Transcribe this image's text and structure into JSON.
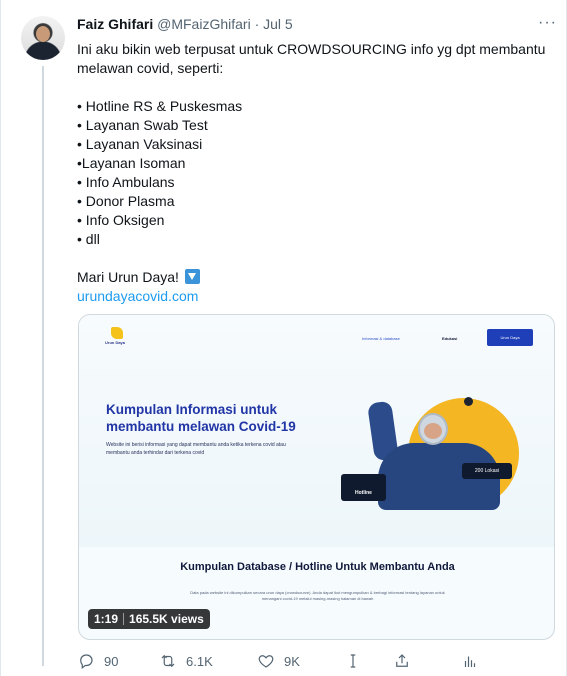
{
  "author": {
    "name": "Faiz Ghifari",
    "handle": "@MFaizGhifari",
    "separator": "·",
    "date": "Jul 5"
  },
  "more_label": "···",
  "tweet": {
    "intro": "Ini aku bikin web terpusat untuk CROWDSOURCING info yg dpt membantu melawan covid, seperti:",
    "list": [
      "• Hotline RS & Puskesmas",
      "• Layanan Swab Test",
      "• Layanan Vaksinasi",
      "•Layanan Isoman",
      "• Info Ambulans",
      "• Donor Plasma",
      "• Info Oksigen",
      "• dll"
    ],
    "cta": "Mari Urun Daya!",
    "link": "urundayacovid.com"
  },
  "media": {
    "logo_text": "Urun Daya",
    "nav_info": "Informasi & database",
    "nav_edukasi": "Edukasi",
    "nav_button": "Urun Daya",
    "hero_title": "Kumpulan Informasi untuk membantu melawan Covid-19",
    "hero_sub": "Website ini berisi informasi yang dapat membantu anda ketika terkena covid atau membantu anda terhindar dari terkena covid",
    "hotline_label": "Hotline",
    "lokasi_label": "200 Lokasi",
    "section_title": "Kumpulan Database / Hotline Untuk Membantu Anda",
    "section_sub": "Data pada website ini dikumpulkan secara urun daya (crowdsource). Anda dapat ikut mengumpulkan & berbagi informasi tentang layanan untuk menangani covid-19 melalui masing-masing halaman di bawah",
    "duration": "1:19",
    "views": "165.5K views"
  },
  "actions": {
    "replies": "90",
    "retweets": "6.1K",
    "likes": "9K",
    "reply_icon": "reply-icon",
    "retweet_icon": "retweet-icon",
    "like_icon": "heart-icon",
    "cursor_icon": "text-cursor-icon",
    "share_icon": "share-icon",
    "analytics_icon": "analytics-icon"
  },
  "colors": {
    "link": "#1d9bf0",
    "secondary_text": "#536471",
    "hero_title": "#2136a6",
    "accent_yellow": "#f4b622"
  }
}
